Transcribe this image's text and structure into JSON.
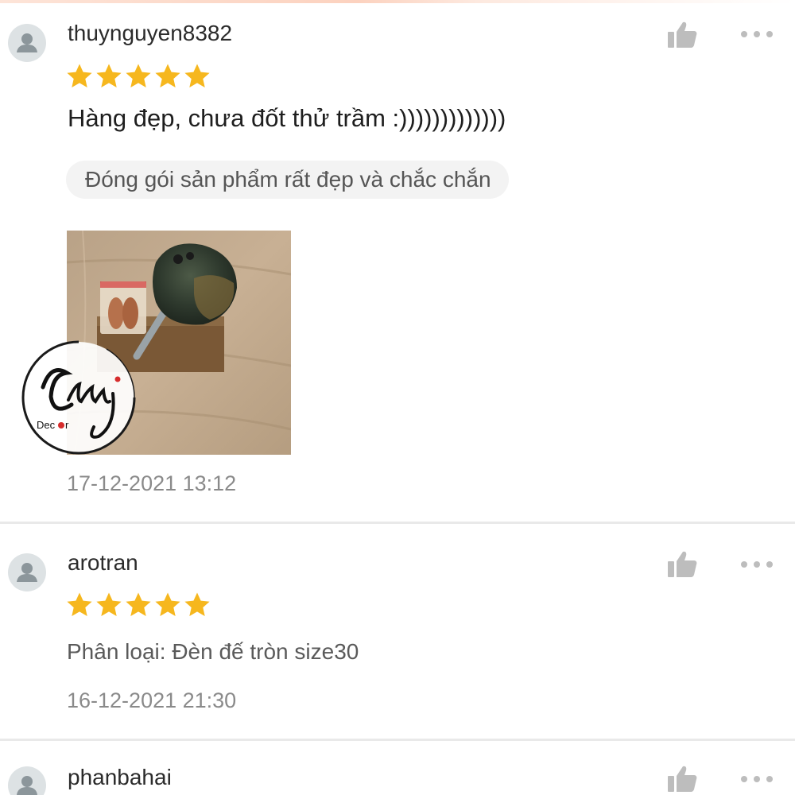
{
  "colors": {
    "star": "#f6b71e",
    "icon_gray": "#bdbdbd",
    "avatar_bg": "#dde2e4",
    "divider": "#e9e9e9"
  },
  "reviews": [
    {
      "username": "thuynguyen8382",
      "rating": 5,
      "text": "Hàng đẹp, chưa đốt thử  trầm :)))))))))))))",
      "tags": [
        "Đóng gói sản phẩm rất đẹp và chắc chắn"
      ],
      "photo": {
        "icon": "product-photo",
        "watermark_text": "Chay",
        "watermark_subtext": "Decor"
      },
      "date": "17-12-2021 13:12",
      "icons": {
        "avatar": "user-icon",
        "like": "thumbs-up-icon",
        "more": "more-dots-icon"
      }
    },
    {
      "username": "arotran",
      "rating": 5,
      "variant": "Phân loại: Đèn đế tròn size30",
      "date": "16-12-2021 21:30",
      "icons": {
        "avatar": "user-icon",
        "like": "thumbs-up-icon",
        "more": "more-dots-icon"
      }
    },
    {
      "username": "phanbahai",
      "icons": {
        "avatar": "user-icon",
        "like": "thumbs-up-icon",
        "more": "more-dots-icon"
      }
    }
  ]
}
